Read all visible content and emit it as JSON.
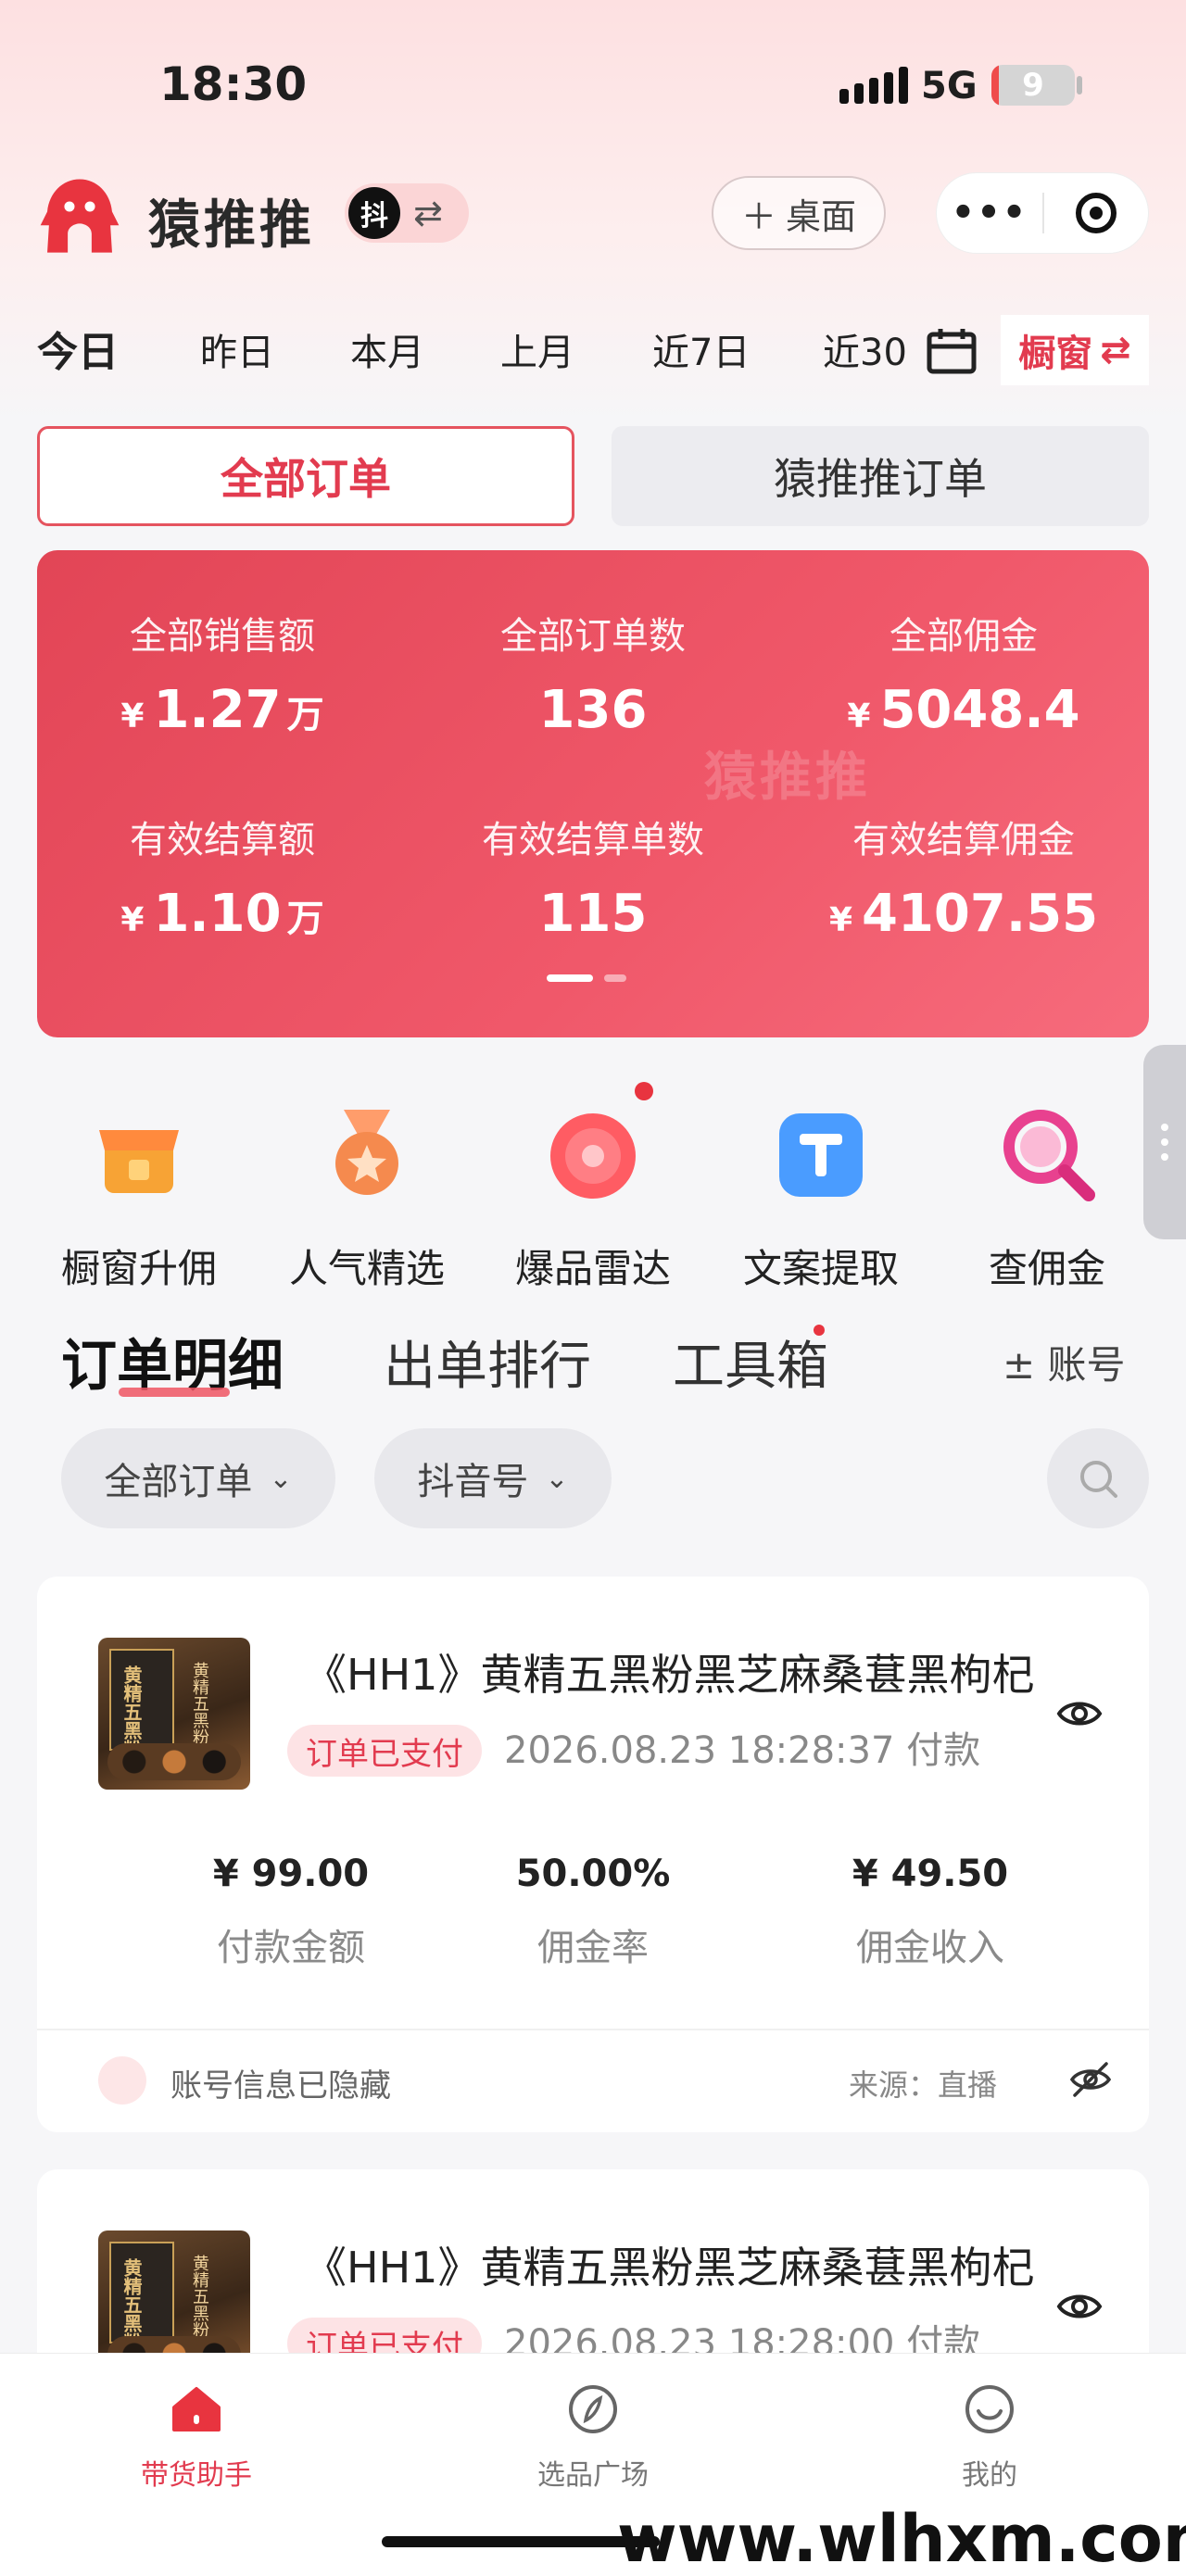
{
  "status_bar": {
    "time": "18:30",
    "network": "5G",
    "battery_level": "9",
    "battery_fraction": 0.09
  },
  "header": {
    "title": "猿推推",
    "douyin_badge": "抖",
    "desktop_button": "桌面"
  },
  "date_tabs": [
    "今日",
    "昨日",
    "本月",
    "上月",
    "近7日",
    "近30"
  ],
  "window_button": "橱窗",
  "order_tabs": {
    "all": "全部订单",
    "app": "猿推推订单"
  },
  "stats": {
    "watermark": "猿推推",
    "currency": "¥",
    "items": [
      {
        "label": "全部销售额",
        "value": "1.27",
        "unit": "万",
        "currency": true
      },
      {
        "label": "全部订单数",
        "value": "136",
        "unit": "",
        "currency": false
      },
      {
        "label": "全部佣金",
        "value": "5048.4",
        "unit": "",
        "currency": true
      },
      {
        "label": "有效结算额",
        "value": "1.10",
        "unit": "万",
        "currency": true
      },
      {
        "label": "有效结算单数",
        "value": "115",
        "unit": "",
        "currency": false
      },
      {
        "label": "有效结算佣金",
        "value": "4107.55",
        "unit": "",
        "currency": true
      }
    ]
  },
  "tools": [
    {
      "label": "橱窗升佣",
      "icon": "shop-icon"
    },
    {
      "label": "人气精选",
      "icon": "medal-icon"
    },
    {
      "label": "爆品雷达",
      "icon": "radar-icon"
    },
    {
      "label": "文案提取",
      "icon": "text-t-icon"
    },
    {
      "label": "查佣金",
      "icon": "magnifier-icon"
    }
  ],
  "section_tabs": [
    "订单明细",
    "出单排行",
    "工具箱"
  ],
  "account_toggle": "± 账号",
  "filters": {
    "order_filter": "全部订单",
    "account_filter": "抖音号"
  },
  "orders": [
    {
      "thumb_text": "黄精五黑粉",
      "thumb_side": "黄精五黑粉",
      "title": "《HH1》黄精五黑粉黑芝麻桑葚黑枸杞",
      "status": "订单已支付",
      "pay_time": "2026.08.23 18:28:37 付款",
      "payment": "¥ 99.00",
      "payment_label": "付款金额",
      "rate": "50.00%",
      "rate_label": "佣金率",
      "commission": "¥ 49.50",
      "commission_label": "佣金收入",
      "hidden_text": "账号信息已隐藏",
      "source": "来源：直播"
    },
    {
      "thumb_text": "黄精五黑粉",
      "thumb_side": "黄精五黑粉",
      "title": "《HH1》黄精五黑粉黑芝麻桑葚黑枸杞",
      "status": "订单已支付",
      "pay_time": "2026.08.23 18:28:00 付款"
    }
  ],
  "bottom_nav": [
    "带货助手",
    "选品广场",
    "我的"
  ],
  "site_watermark": "www.wlhxm.com",
  "colors": {
    "accent": "#e23b4f",
    "stats_card": "#ef5566",
    "badge_bg": "#fde3e5"
  }
}
